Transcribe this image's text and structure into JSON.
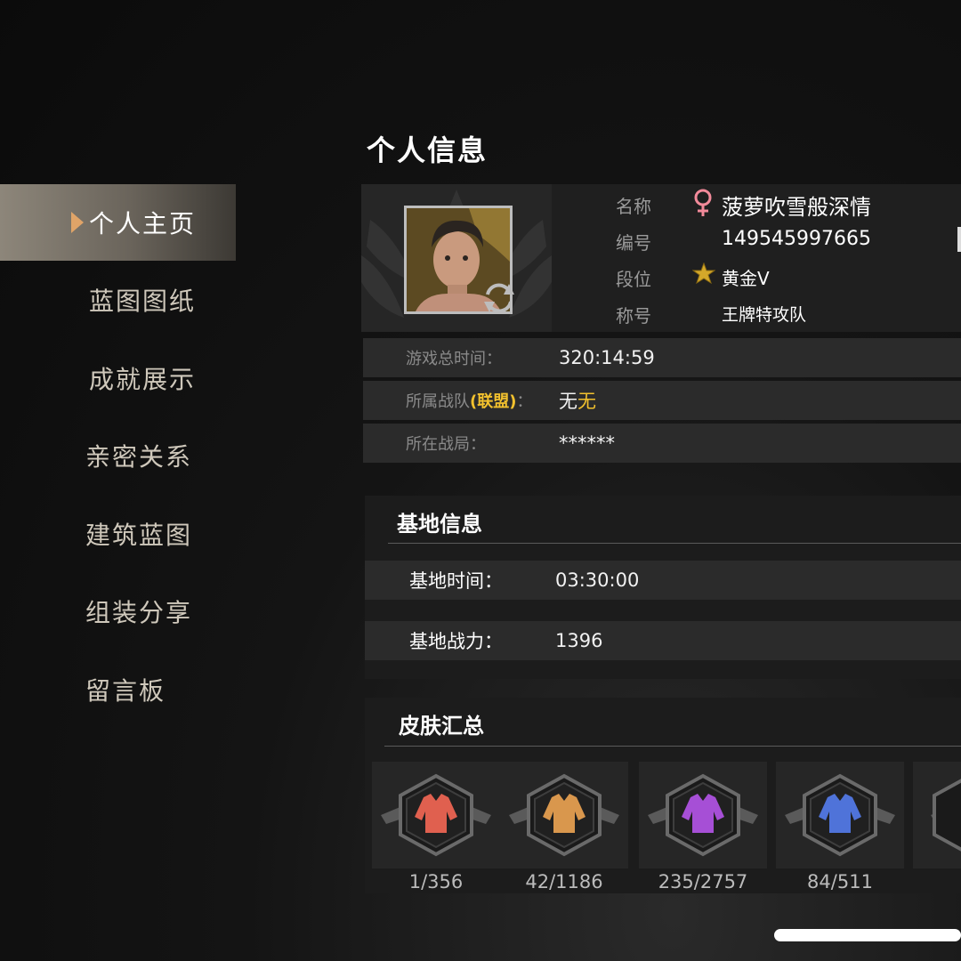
{
  "sidebar": {
    "items": [
      {
        "label": "个人主页",
        "active": true
      },
      {
        "label": "蓝图图纸",
        "active": false
      },
      {
        "label": "成就展示",
        "active": false
      },
      {
        "label": "亲密关系",
        "active": false
      },
      {
        "label": "建筑蓝图",
        "active": false
      },
      {
        "label": "组装分享",
        "active": false
      },
      {
        "label": "留言板",
        "active": false
      }
    ]
  },
  "profile": {
    "section_title": "个人信息",
    "name_label": "名称",
    "name": "菠萝吹雪般深情",
    "id_label": "编号",
    "id": "149545997665",
    "rank_label": "段位",
    "rank": "黄金V",
    "title_label": "称号",
    "title": "王牌特攻队",
    "gender_icon": "female-icon"
  },
  "stats": {
    "playtime_label": "游戏总时间：",
    "playtime": "320:14:59",
    "team_label_prefix": "所属战队",
    "team_label_tag": "(联盟)",
    "team_label_suffix": "：",
    "team_value_a": "无",
    "team_value_b": "无",
    "match_label": "所在战局：",
    "match_value": "******"
  },
  "base": {
    "title": "基地信息",
    "time_label": "基地时间：",
    "time_value": "03:30:00",
    "power_label": "基地战力：",
    "power_value": "1396"
  },
  "skins": {
    "title": "皮肤汇总",
    "items": [
      {
        "count": "1/356",
        "color": "#e0604f"
      },
      {
        "count": "42/1186",
        "color": "#d9974d"
      },
      {
        "count": "235/2757",
        "color": "#a64fd6"
      },
      {
        "count": "84/511",
        "color": "#4f73d9"
      }
    ]
  },
  "colors": {
    "accent_gold": "#f2c12e",
    "female_pink": "#f28a9a"
  }
}
